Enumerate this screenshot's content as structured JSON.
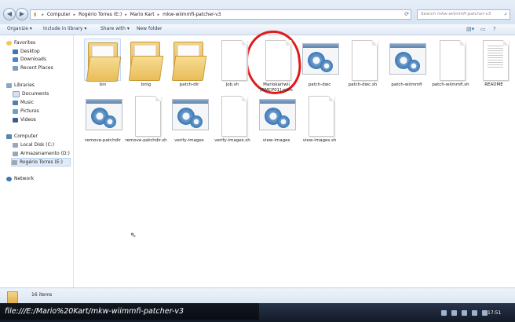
{
  "address": {
    "crumbs": [
      "Computer",
      "Rogério Torres (E:)",
      "Mario Kart",
      "mkw-wiimmfi-patcher-v3"
    ],
    "search_placeholder": "Search mkw-wiimmfi-patcher-v3"
  },
  "toolbar": {
    "organize": "Organize ▾",
    "include": "Include in library ▾",
    "share": "Share with ▾",
    "new_folder": "New folder"
  },
  "nav": {
    "favorites": "Favorites",
    "desktop": "Desktop",
    "downloads": "Downloads",
    "recent": "Recent Places",
    "libraries": "Libraries",
    "documents": "Documents",
    "music": "Music",
    "pictures": "Pictures",
    "videos": "Videos",
    "computer": "Computer",
    "local_disk": "Local Disk (C:)",
    "armazenamento": "Armazenamento (D:)",
    "rogerio": "Rogério Torres (E:)",
    "network": "Network"
  },
  "files": [
    {
      "name": "bin",
      "kind": "folder"
    },
    {
      "name": "bmg",
      "kind": "folder"
    },
    {
      "name": "patch-dir",
      "kind": "folder"
    },
    {
      "name": "job.sh",
      "kind": "file"
    },
    {
      "name": "Mariokartwii [RMCP01].wbfs",
      "kind": "file"
    },
    {
      "name": "patch-dwc",
      "kind": "exe"
    },
    {
      "name": "patch-dwc.sh",
      "kind": "file"
    },
    {
      "name": "patch-wiimmfi",
      "kind": "exe"
    },
    {
      "name": "patch-wiimmfi.sh",
      "kind": "file"
    },
    {
      "name": "README",
      "kind": "text"
    },
    {
      "name": "remove-patchdir",
      "kind": "exe"
    },
    {
      "name": "remove-patchdir.sh",
      "kind": "file"
    },
    {
      "name": "verify-images",
      "kind": "exe"
    },
    {
      "name": "verify-images.sh",
      "kind": "file"
    },
    {
      "name": "view-images",
      "kind": "exe"
    },
    {
      "name": "view-images.sh",
      "kind": "file"
    }
  ],
  "status": {
    "items": "16 items"
  },
  "taskbar": {
    "time": "17:51"
  },
  "overlay": {
    "url": "file:///E:/Mario%20Kart/mkw-wiimmfi-patcher-v3"
  },
  "colors": {
    "annotation": "#e21a1a",
    "selection": "#e0ebf8"
  }
}
